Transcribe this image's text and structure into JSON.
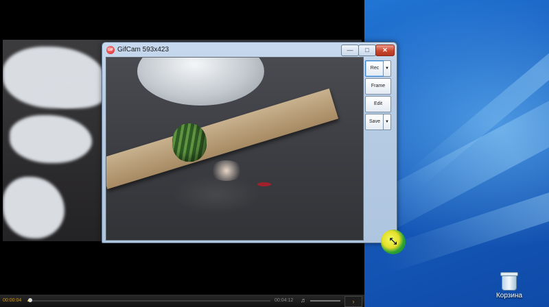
{
  "player": {
    "current_time": "00:00:04",
    "total_time": "00:04:12",
    "progress_fraction": 0.01,
    "volume_icon": "speaker-icon",
    "next_icon": "next-icon",
    "accent_color": "#c99a2e"
  },
  "gifcam": {
    "title": "GifCam 593x423",
    "app_icon_text": "GIF",
    "window_buttons": {
      "minimize": "—",
      "maximize": "□",
      "close": "✕"
    },
    "buttons": {
      "rec": "Rec",
      "frame": "Frame",
      "edit": "Edit",
      "save": "Save",
      "dropdown_arrow": "▼"
    }
  },
  "desktop": {
    "recycle_bin_label": "Корзина",
    "recycle_bin_icon": "recycle-bin-icon"
  },
  "cursor": {
    "icon": "resize-cursor-icon",
    "glyph": "⤡"
  }
}
